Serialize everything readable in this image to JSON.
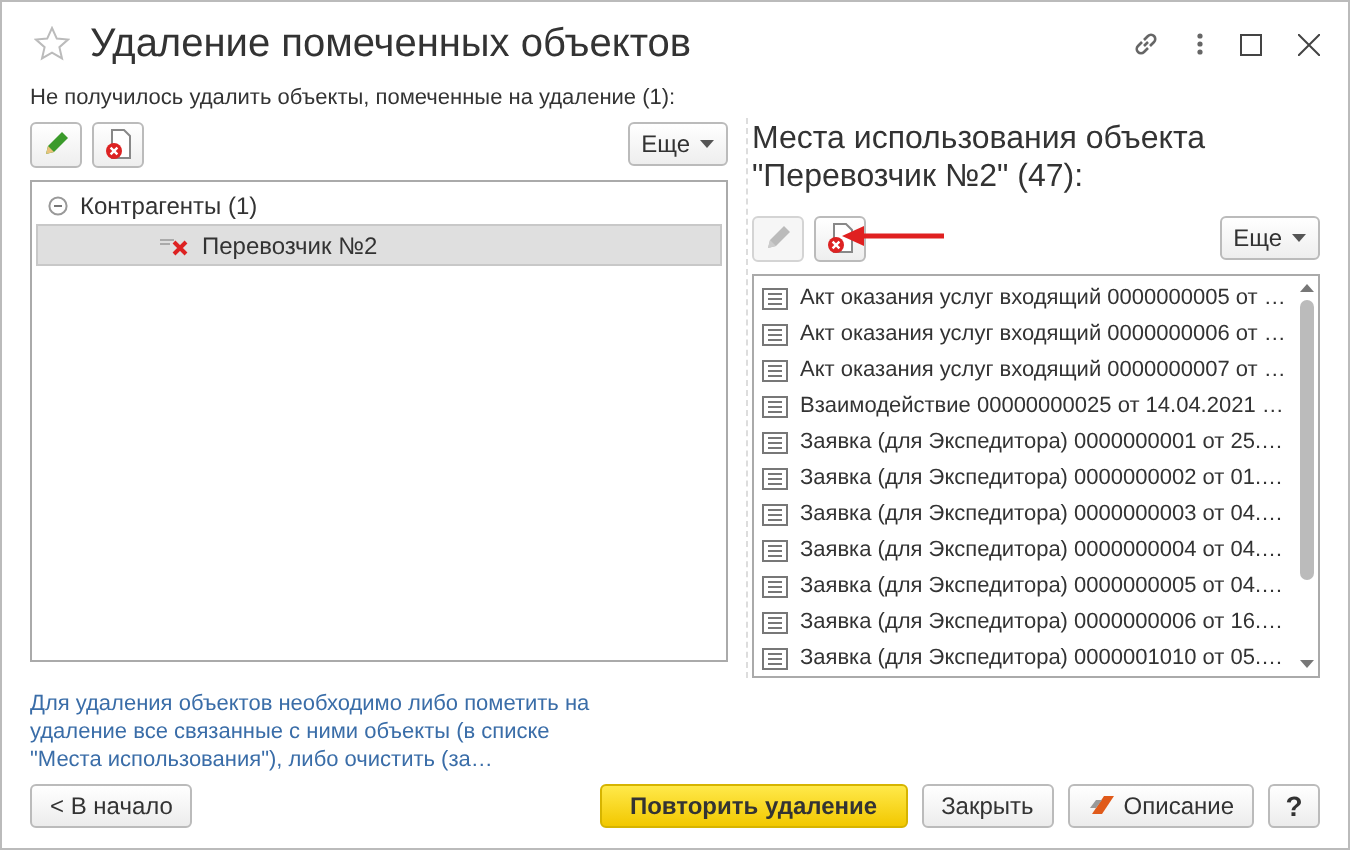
{
  "window": {
    "title": "Удаление помеченных объектов"
  },
  "message": "Не получилось удалить объекты, помеченные на удаление (1):",
  "left_toolbar": {
    "buttons": [
      {
        "kind": "edit",
        "disabled": false
      },
      {
        "kind": "delete",
        "disabled": false
      }
    ],
    "more": "Еще"
  },
  "tree": [
    {
      "label": "Контрагенты (1)",
      "expanded": true,
      "selected": false,
      "children": [
        {
          "label": "Перевозчик №2",
          "selected": true
        }
      ]
    }
  ],
  "usage_title": "Места использования объекта \"Перевозчик №2\" (47):",
  "right_toolbar": {
    "buttons": [
      {
        "kind": "edit",
        "disabled": true
      },
      {
        "kind": "delete",
        "disabled": false
      }
    ],
    "more": "Еще"
  },
  "usage_list": [
    "Акт оказания услуг входящий 0000000005 от …",
    "Акт оказания услуг входящий 0000000006 от …",
    "Акт оказания услуг входящий 0000000007 от …",
    "Взаимодействие 00000000025 от 14.04.2021 …",
    "Заявка (для Экспедитора) 0000000001 от 25.…",
    "Заявка (для Экспедитора) 0000000002 от 01.…",
    "Заявка (для Экспедитора) 0000000003 от 04.…",
    "Заявка (для Экспедитора) 0000000004 от 04.…",
    "Заявка (для Экспедитора) 0000000005 от 04.…",
    "Заявка (для Экспедитора) 0000000006 от 16.…",
    "Заявка (для Экспедитора) 0000001010 от 05.…"
  ],
  "hint": "Для удаления объектов необходимо либо пометить на удаление все связанные с ними объекты (в списке \"Места использования\"), либо очистить (за…",
  "buttons": [
    {
      "kind": "back",
      "label": "< В начало"
    },
    {
      "kind": "primary",
      "label": "Повторить удаление"
    },
    {
      "kind": "plain",
      "label": "Закрыть"
    },
    {
      "kind": "help",
      "label": "Описание"
    },
    {
      "kind": "question",
      "label": "?"
    }
  ]
}
